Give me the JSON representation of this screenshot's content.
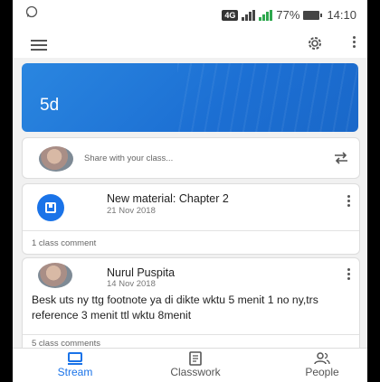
{
  "statusbar": {
    "network": "4G",
    "battery": "77%",
    "time": "14:10"
  },
  "appbar": {
    "menu_icon": "menu-icon",
    "settings_icon": "gear-icon",
    "more_icon": "more-vert-icon"
  },
  "banner": {
    "class_name": "5d",
    "color": "#1c6fd3"
  },
  "share": {
    "placeholder": "Share with your class...",
    "icon": "repost-icon"
  },
  "material": {
    "title": "New material: Chapter 2",
    "date": "21 Nov 2018",
    "comments": "1 class comment"
  },
  "post": {
    "author": "Nurul Puspita",
    "date": "14 Nov 2018",
    "body": "Besk uts ny ttg footnote ya di dikte wktu 5 menit 1 no ny,trs reference 3 menit ttl wktu 8menit",
    "comments": "5 class comments"
  },
  "bottomnav": {
    "items": [
      {
        "label": "Stream",
        "icon": "stream-icon",
        "active": true
      },
      {
        "label": "Classwork",
        "icon": "classwork-icon",
        "active": false
      },
      {
        "label": "People",
        "icon": "people-icon",
        "active": false
      }
    ],
    "active_color": "#1a73e8"
  }
}
